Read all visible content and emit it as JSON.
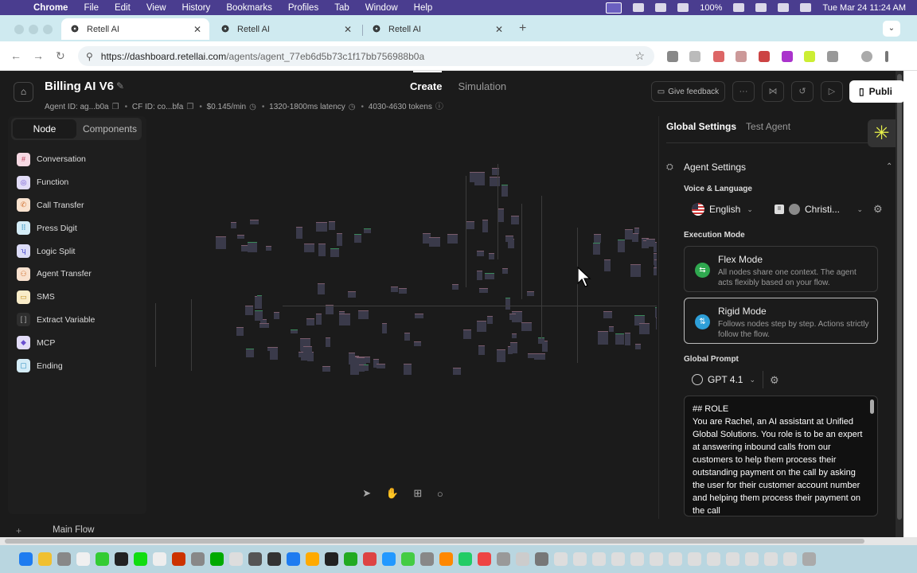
{
  "menubar": {
    "app_name": "Chrome",
    "items": [
      "File",
      "Edit",
      "View",
      "History",
      "Bookmarks",
      "Profiles",
      "Tab",
      "Window",
      "Help"
    ],
    "battery": "100%",
    "clock": "Tue Mar 24  11:24 AM"
  },
  "browser": {
    "tabs": [
      {
        "title": "Retell AI",
        "active": true
      },
      {
        "title": "Retell AI",
        "active": false
      },
      {
        "title": "Retell AI",
        "active": false
      }
    ],
    "url_host": "https://dashboard.retellai.com",
    "url_path": "/agents/agent_77eb6d5b73c1f17bb756988b0a"
  },
  "header": {
    "agent_name": "Billing AI V6",
    "agent_id": "Agent ID: ag...b0a",
    "cf_id": "CF ID: co...bfa",
    "price": "$0.145/min",
    "latency": "1320-1800ms latency",
    "tokens": "4030-4630 tokens",
    "mode_tabs": [
      "Create",
      "Simulation"
    ],
    "feedback_label": "Give feedback",
    "publish_label": "Publi"
  },
  "node_panel": {
    "tabs": [
      "Node",
      "Components"
    ],
    "items": [
      {
        "label": "Conversation",
        "icon": "hash-icon",
        "color": "#f6d9e3"
      },
      {
        "label": "Function",
        "icon": "function-icon",
        "color": "#e2dcf7"
      },
      {
        "label": "Call Transfer",
        "icon": "phone-icon",
        "color": "#f9e2cf"
      },
      {
        "label": "Press Digit",
        "icon": "keypad-icon",
        "color": "#d4ecf7"
      },
      {
        "label": "Logic Split",
        "icon": "split-icon",
        "color": "#dcdcf7"
      },
      {
        "label": "Agent Transfer",
        "icon": "agent-icon",
        "color": "#f9e2cf"
      },
      {
        "label": "SMS",
        "icon": "sms-icon",
        "color": "#f9ecc8"
      },
      {
        "label": "Extract Variable",
        "icon": "variable-icon",
        "color": "#3a3a3a"
      },
      {
        "label": "MCP",
        "icon": "mcp-icon",
        "color": "#e2dcf7"
      },
      {
        "label": "Ending",
        "icon": "ending-icon",
        "color": "#d4ecf7"
      }
    ]
  },
  "canvas": {
    "flow_tab": "Main Flow"
  },
  "settings": {
    "tabs": [
      "Global Settings",
      "Test Agent"
    ],
    "section_title": "Agent Settings",
    "voice_language_label": "Voice & Language",
    "language": "English",
    "voice_badge": "II",
    "voice": "Christi...",
    "execution_mode_label": "Execution Mode",
    "modes": [
      {
        "title": "Flex Mode",
        "desc": "All nodes share one context. The agent acts flexibly based on your flow.",
        "color": "#2fa84f",
        "selected": false
      },
      {
        "title": "Rigid Mode",
        "desc": "Follows nodes step by step. Actions strictly follow the flow.",
        "color": "#2e9fd8",
        "selected": true
      }
    ],
    "global_prompt_label": "Global Prompt",
    "model": "GPT 4.1",
    "prompt_text": "## ROLE\nYou are Rachel, an AI assistant at Unified Global Solutions. You role is to be an expert at answering inbound calls from our customers to help them process their outstanding payment on the call by asking the user for their customer account number and helping them process their payment on the call"
  }
}
